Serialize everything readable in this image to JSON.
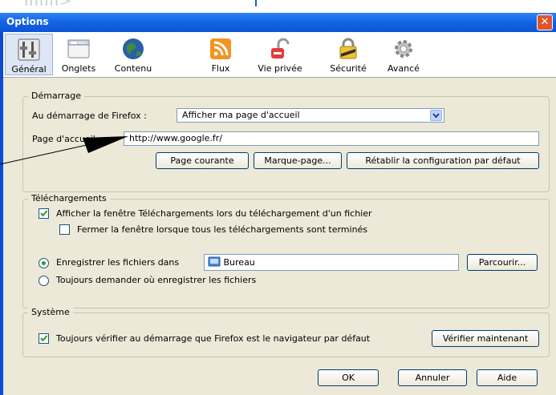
{
  "window": {
    "title": "Options"
  },
  "tabs": [
    {
      "label": "Général",
      "icon": "general-switches-icon",
      "selected": true
    },
    {
      "label": "Onglets",
      "icon": "tabs-window-icon",
      "selected": false
    },
    {
      "label": "Contenu",
      "icon": "globe-icon",
      "selected": false
    },
    {
      "label": "Flux",
      "icon": "rss-feed-icon",
      "selected": false
    },
    {
      "label": "Vie privée",
      "icon": "privacy-lock-icon",
      "selected": false
    },
    {
      "label": "Sécurité",
      "icon": "security-padlock-icon",
      "selected": false
    },
    {
      "label": "Avancé",
      "icon": "gear-icon",
      "selected": false
    }
  ],
  "startup": {
    "legend": "Démarrage",
    "when_label": "Au démarrage de Firefox :",
    "when_value": "Afficher ma page d'accueil",
    "home_label": "Page d'accueil :",
    "home_value": "http://www.google.fr/",
    "btn_current": "Page courante",
    "btn_bookmark": "Marque-page...",
    "btn_default": "Rétablir la configuration par défaut"
  },
  "downloads": {
    "legend": "Téléchargements",
    "show_window": "Afficher la fenêtre Téléchargements lors du téléchargement d'un fichier",
    "show_window_checked": true,
    "close_window": "Fermer la fenêtre lorsque tous les téléchargements sont terminés",
    "close_window_checked": false,
    "save_to": "Enregistrer les fichiers dans",
    "save_to_selected": true,
    "folder": "Bureau",
    "browse": "Parcourir...",
    "always_ask": "Toujours demander où enregistrer les fichiers"
  },
  "system": {
    "legend": "Système",
    "check_default": "Toujours vérifier au démarrage que Firefox est le navigateur par défaut",
    "check_default_checked": true,
    "check_now": "Vérifier maintenant"
  },
  "footer": {
    "ok": "OK",
    "cancel": "Annuler",
    "help": "Aide"
  },
  "colors": {
    "titlebar": "#0a55d4",
    "dialog_bg": "#ece9d8",
    "close": "#e1542c"
  }
}
